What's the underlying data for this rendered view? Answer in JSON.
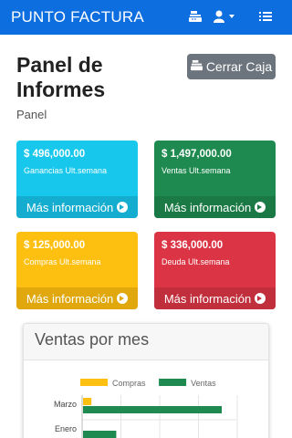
{
  "navbar": {
    "brand": "PUNTO FACTURA",
    "icons": [
      "cash-register-icon",
      "user-icon",
      "caret-down-icon",
      "list-menu-icon"
    ]
  },
  "page": {
    "title": "Panel de Informes",
    "breadcrumb": "Panel",
    "close_button_label": "Cerrar Caja"
  },
  "cards": [
    {
      "value": "$ 496,000.00",
      "label": "Ganancias Ult.semana",
      "link": "Más información",
      "color": "#17c7ec"
    },
    {
      "value": "$ 1,497,000.00",
      "label": "Ventas Ult.semana",
      "link": "Más información",
      "color": "#1e8a4f"
    },
    {
      "value": "$ 125,000.00",
      "label": "Compras Ult.semana",
      "link": "Más información",
      "color": "#fdbf10"
    },
    {
      "value": "$ 336,000.00",
      "label": "Deuda Ult.semana",
      "link": "Más información",
      "color": "#db3545"
    }
  ],
  "sales_panel": {
    "title": "Ventas por mes"
  },
  "chart_data": {
    "type": "bar",
    "orientation": "horizontal",
    "categories": [
      "Marzo",
      "Enero"
    ],
    "series": [
      {
        "name": "Compras",
        "color": "#fdbf10",
        "values": [
          6,
          null
        ]
      },
      {
        "name": "Ventas",
        "color": "#1e8a4f",
        "values": [
          90,
          22
        ]
      }
    ],
    "xlim": [
      0,
      100
    ],
    "grid": true,
    "legend": "top"
  }
}
